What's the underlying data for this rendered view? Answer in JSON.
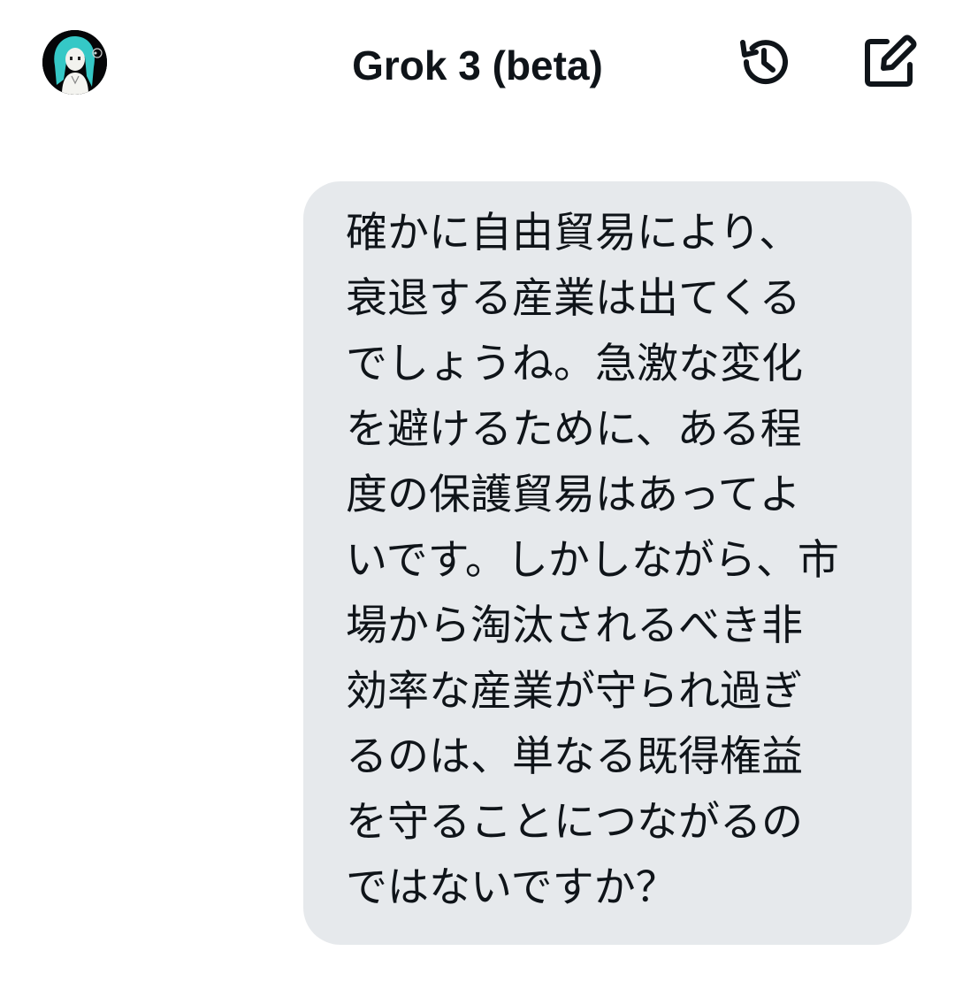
{
  "header": {
    "title": "Grok 3 (beta)",
    "avatar_icon": "user-avatar-anime-character",
    "history_icon": "history-icon",
    "compose_icon": "new-chat-compose-icon"
  },
  "messages": [
    {
      "role": "user",
      "text": "確かに自由貿易により、衰退する産業は出てくるでしょうね。急激な変化を避けるために、ある程度の保護貿易はあってよいです。しかしながら、市場から淘汰されるべき非効率な産業が守られ過ぎるのは、単なる既得権益を守ることにつながるのではないですか？"
    }
  ],
  "colors": {
    "background": "#ffffff",
    "bubble": "#e6e9ec",
    "text": "#0f1419"
  }
}
